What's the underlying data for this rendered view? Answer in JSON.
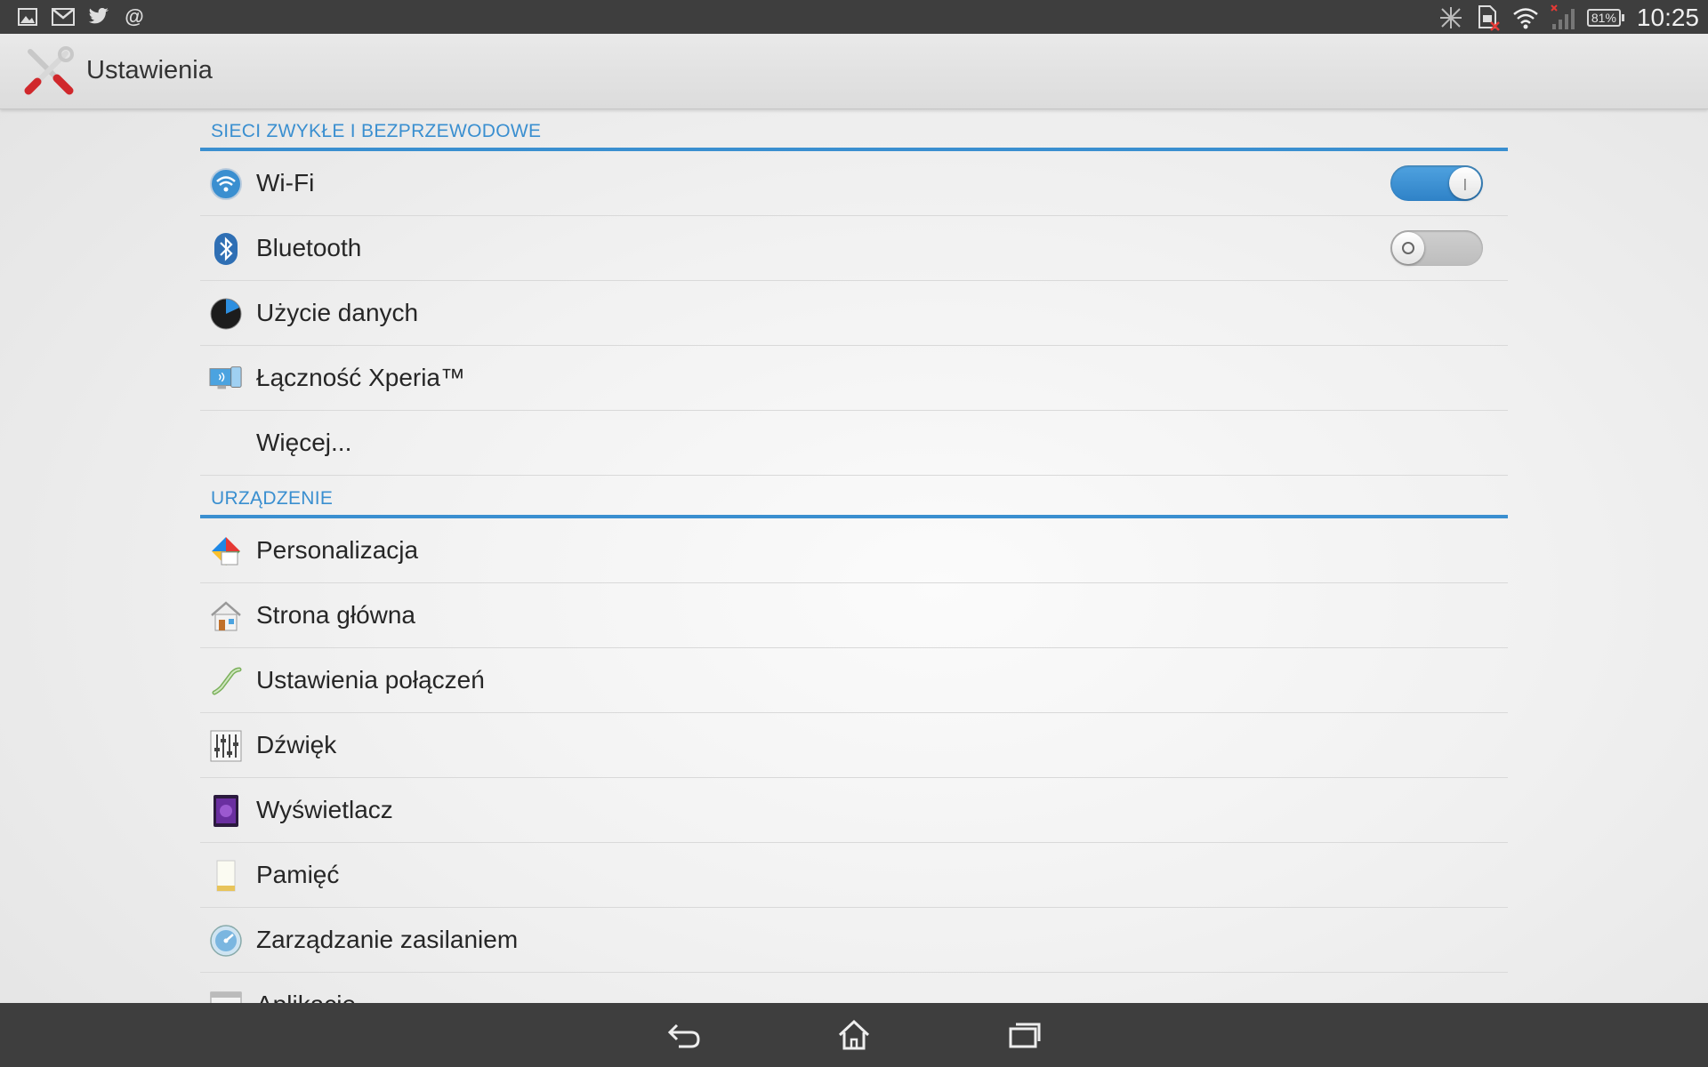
{
  "status_bar": {
    "left_icons": [
      "image-icon",
      "gmail-icon",
      "twitter-icon",
      "at-sign-icon"
    ],
    "right_icons": [
      "nfc-off-icon",
      "sim-missing-icon",
      "wifi-icon",
      "signal-no-service-icon"
    ],
    "battery": "81%",
    "time": "10:25"
  },
  "action_bar": {
    "title": "Ustawienia",
    "icon": "settings-tools-icon"
  },
  "sections": [
    {
      "header": "SIECI ZWYKŁE I BEZPRZEWODOWE",
      "items": [
        {
          "label": "Wi-Fi",
          "icon": "wifi-icon",
          "toggle": "on"
        },
        {
          "label": "Bluetooth",
          "icon": "bluetooth-icon",
          "toggle": "off"
        },
        {
          "label": "Użycie danych",
          "icon": "data-usage-icon"
        },
        {
          "label": "Łączność Xperia™",
          "icon": "xperia-connectivity-icon"
        },
        {
          "label": "Więcej...",
          "icon": ""
        }
      ]
    },
    {
      "header": "URZĄDZENIE",
      "items": [
        {
          "label": "Personalizacja",
          "icon": "personalization-icon"
        },
        {
          "label": "Strona główna",
          "icon": "home-screen-icon"
        },
        {
          "label": "Ustawienia połączeń",
          "icon": "call-settings-icon"
        },
        {
          "label": "Dźwięk",
          "icon": "sound-equalizer-icon"
        },
        {
          "label": "Wyświetlacz",
          "icon": "display-icon"
        },
        {
          "label": "Pamięć",
          "icon": "memory-card-icon"
        },
        {
          "label": "Zarządzanie zasilaniem",
          "icon": "power-management-icon"
        },
        {
          "label": "Aplikacje",
          "icon": "apps-icon"
        }
      ]
    }
  ],
  "nav_bar": {
    "buttons": [
      "back-icon",
      "home-icon",
      "recent-apps-icon"
    ]
  },
  "colors": {
    "accent": "#3a8fd0",
    "status_bar": "#3e3e3e",
    "action_bar": "#e2e2e2"
  }
}
